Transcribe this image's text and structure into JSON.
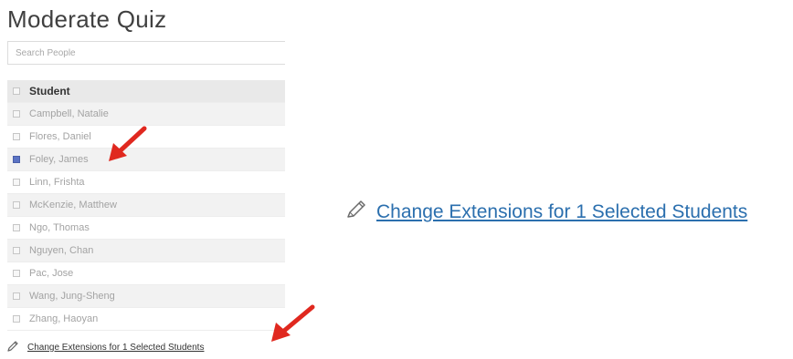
{
  "page": {
    "title": "Moderate Quiz"
  },
  "search": {
    "placeholder": "Search People"
  },
  "table": {
    "header": "Student",
    "students": [
      {
        "name": "Campbell, Natalie",
        "checked": false
      },
      {
        "name": "Flores, Daniel",
        "checked": false
      },
      {
        "name": "Foley, James",
        "checked": true
      },
      {
        "name": "Linn, Frishta",
        "checked": false
      },
      {
        "name": "McKenzie, Matthew",
        "checked": false
      },
      {
        "name": "Ngo, Thomas",
        "checked": false
      },
      {
        "name": "Nguyen, Chan",
        "checked": false
      },
      {
        "name": "Pac, Jose",
        "checked": false
      },
      {
        "name": "Wang, Jung-Sheng",
        "checked": false
      },
      {
        "name": "Zhang, Haoyan",
        "checked": false
      }
    ]
  },
  "actions": {
    "change_extensions_small": "Change Extensions for 1 Selected Students",
    "change_extensions_large": "Change Extensions for 1 Selected Students"
  },
  "colors": {
    "link_blue": "#2b6fae",
    "arrow_red": "#e0281f",
    "checkbox_checked": "#5b73c4"
  },
  "icons": {
    "edit": "pencil-icon",
    "annotation": "red-arrow-icon"
  }
}
